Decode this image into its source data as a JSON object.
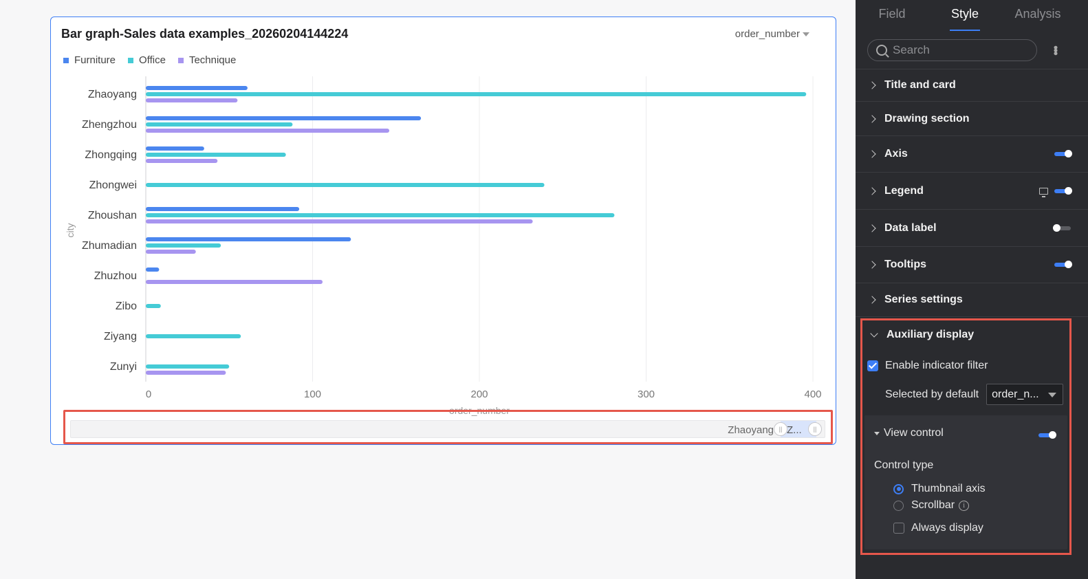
{
  "card": {
    "title": "Bar graph-Sales data examples_20260204144224",
    "metric_selector": "order_number"
  },
  "colors": {
    "accent": "#3d7ef5",
    "highlight": "#e5574b",
    "panel_bg": "#2a2b2f"
  },
  "chart_data": {
    "type": "bar",
    "orientation": "horizontal",
    "categories": [
      "Zhaoyang",
      "Zhengzhou",
      "Zhongqing",
      "Zhongwei",
      "Zhoushan",
      "Zhumadian",
      "Zhuzhou",
      "Zibo",
      "Ziyang",
      "Zunyi"
    ],
    "series": [
      {
        "name": "Furniture",
        "color": "#4b86ef",
        "values": [
          61,
          165,
          35,
          0,
          92,
          123,
          8,
          0,
          0,
          0
        ]
      },
      {
        "name": "Office",
        "color": "#45cbd6",
        "values": [
          396,
          88,
          84,
          239,
          281,
          45,
          0,
          9,
          57,
          50
        ]
      },
      {
        "name": "Technique",
        "color": "#a795f0",
        "values": [
          55,
          146,
          43,
          0,
          232,
          30,
          106,
          0,
          0,
          48
        ]
      }
    ],
    "xlabel": "order_number",
    "ylabel": "city",
    "xlim": [
      0,
      400
    ],
    "xticks": [
      "0",
      "100",
      "200",
      "300",
      "400"
    ],
    "grid": "vertical",
    "legend_position": "top-left"
  },
  "thumbnail": {
    "start_label": "Zhaoyang",
    "window_label": "Z..."
  },
  "panel": {
    "tabs": [
      "Field",
      "Style",
      "Analysis"
    ],
    "active_tab": "Style",
    "search_placeholder": "Search",
    "sections": {
      "title_card": "Title and card",
      "drawing": "Drawing section",
      "axis": "Axis",
      "legend": "Legend",
      "data_label": "Data label",
      "tooltips": "Tooltips",
      "series": "Series settings"
    },
    "toggles": {
      "axis": true,
      "legend": true,
      "data_label": false,
      "tooltips": true
    },
    "auxiliary": {
      "title": "Auxiliary display",
      "enable_indicator_filter": "Enable indicator filter",
      "selected_by_default_label": "Selected by default",
      "selected_by_default_value": "order_n...",
      "view_control": "View control",
      "control_type": "Control type",
      "option_thumbnail": "Thumbnail axis",
      "option_scrollbar": "Scrollbar",
      "always_display": "Always display"
    }
  }
}
